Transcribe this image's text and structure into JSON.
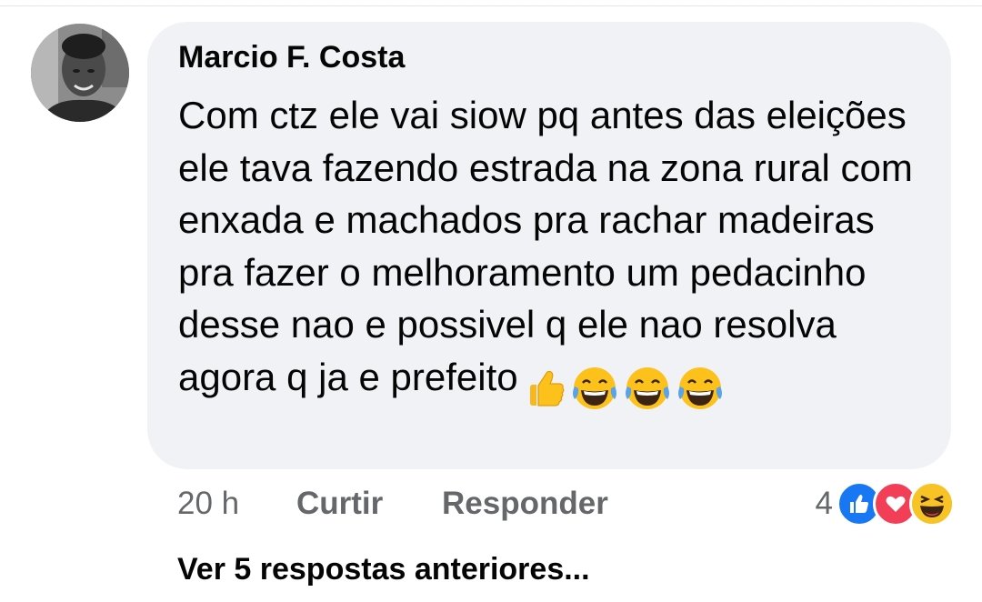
{
  "comment": {
    "author": "Marcio F. Costa",
    "text": "Com ctz ele vai siow pq antes das eleições ele tava fazendo estrada na zona rural com enxada e machados pra rachar madeiras pra fazer o melhoramento um pedacinho desse nao e possivel q ele nao resolva agora q ja e prefeito",
    "emojis": [
      "thumbs-up-emoji",
      "tears-of-joy-emoji",
      "tears-of-joy-emoji",
      "tears-of-joy-emoji"
    ],
    "timestamp": "20 h",
    "like_label": "Curtir",
    "reply_label": "Responder",
    "reaction_count": "4",
    "reactions": [
      "like-reaction-icon",
      "love-reaction-icon",
      "haha-reaction-icon"
    ]
  },
  "view_more_replies": "Ver 5 respostas anteriores...",
  "colors": {
    "bubble_bg": "#f0f2f5",
    "text": "#050505",
    "secondary_text": "#65676b",
    "like_blue": "#1877f2",
    "love_red": "#f33e58",
    "haha_yellow": "#f7b125"
  }
}
